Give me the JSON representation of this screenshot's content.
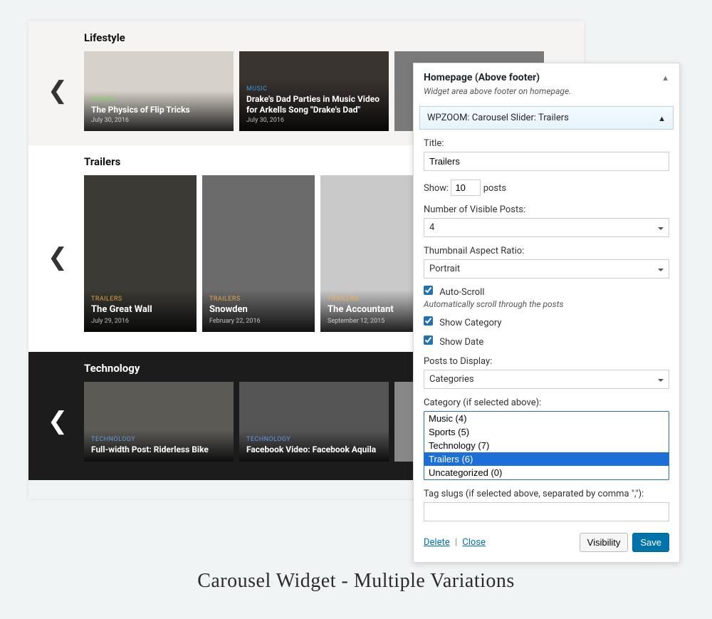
{
  "caption": "Carousel Widget - Multiple Variations",
  "preview": {
    "sections": [
      {
        "title": "Lifestyle",
        "cards": [
          {
            "category": "SPORTS",
            "title": "The Physics of Flip Tricks",
            "date": "July 30, 2016"
          },
          {
            "category": "MUSIC",
            "title": "Drake's Dad Parties in Music Video for Arkells Song \"Drake's Dad\"",
            "date": "July 30, 2016"
          },
          {
            "category": "",
            "title": "",
            "date": ""
          }
        ]
      },
      {
        "title": "Trailers",
        "cards": [
          {
            "category": "TRAILERS",
            "title": "The Great Wall",
            "date": "July 29, 2016"
          },
          {
            "category": "TRAILERS",
            "title": "Snowden",
            "date": "February 22, 2016"
          },
          {
            "category": "TRAILERS",
            "title": "The Accountant",
            "date": "September 12, 2015"
          },
          {
            "category": "",
            "title": "",
            "date": ""
          }
        ]
      },
      {
        "title": "Technology",
        "cards": [
          {
            "category": "TECHNOLOGY",
            "title": "Full-width Post: Riderless Bike",
            "date": ""
          },
          {
            "category": "TECHNOLOGY",
            "title": "Facebook Video: Facebook Aquila",
            "date": ""
          },
          {
            "category": "",
            "title": "",
            "date": ""
          }
        ]
      }
    ]
  },
  "panel": {
    "header": "Homepage (Above footer)",
    "description": "Widget area above footer on homepage.",
    "widget_name_prefix": "WPZOOM: Carousel Slider:",
    "widget_name_value": "Trailers"
  },
  "form": {
    "title_label": "Title:",
    "title_value": "Trailers",
    "show_label": "Show:",
    "show_value": "10",
    "show_suffix": "posts",
    "visible_label": "Number of Visible Posts:",
    "visible_value": "4",
    "aspect_label": "Thumbnail Aspect Ratio:",
    "aspect_value": "Portrait",
    "auto_scroll_label": "Auto-Scroll",
    "auto_scroll_hint": "Automatically scroll through the posts",
    "show_category_label": "Show Category",
    "show_date_label": "Show Date",
    "posts_to_display_label": "Posts to Display:",
    "posts_to_display_value": "Categories",
    "category_label": "Category (if selected above):",
    "categories": [
      {
        "label": "Music (4)"
      },
      {
        "label": "Sports (5)"
      },
      {
        "label": "Technology (7)"
      },
      {
        "label": "Trailers (6)"
      },
      {
        "label": "Uncategorized (0)"
      }
    ],
    "tags_label": "Tag slugs (if selected above, separated by comma \",\"):",
    "tags_value": "",
    "delete": "Delete",
    "close": "Close",
    "visibility": "Visibility",
    "save": "Save"
  }
}
